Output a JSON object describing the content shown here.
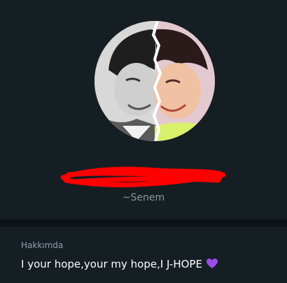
{
  "profile": {
    "avatar_icon": "profile-photo",
    "name_redacted": true,
    "username": "~Senem"
  },
  "about": {
    "heading": "Hakkımda",
    "text": "I your hope,your my hope,I J-HOPE",
    "emoji_icon": "purple-heart-icon",
    "emoji_color": "#9b4dea"
  },
  "colors": {
    "background": "#151e23",
    "divider": "#0d1418",
    "redaction": "#ff0000"
  }
}
